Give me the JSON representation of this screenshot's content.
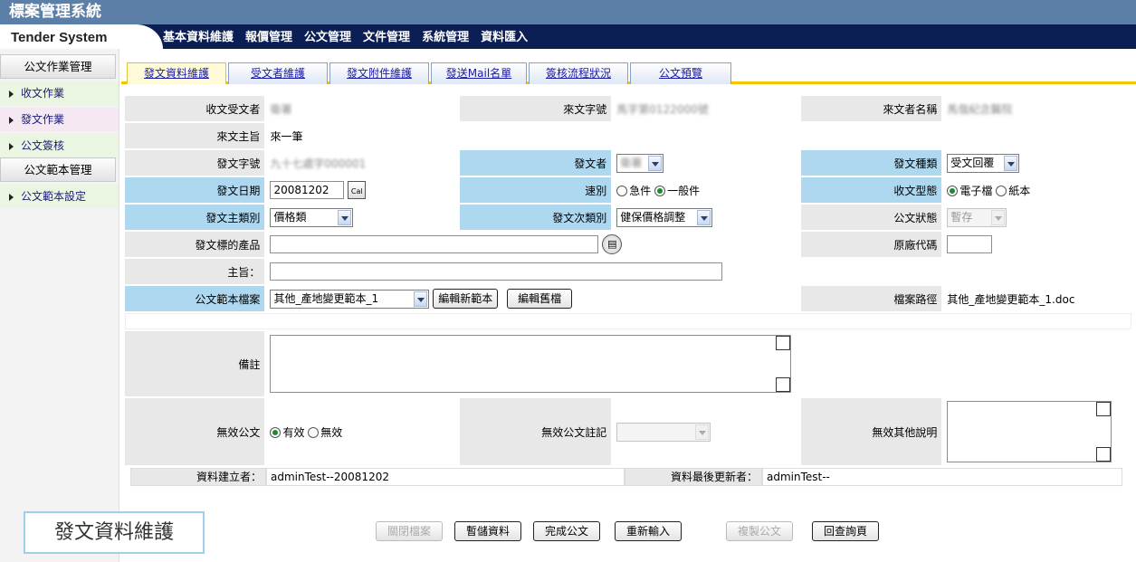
{
  "app": {
    "title": "標案管理系統",
    "brand": "Tender System"
  },
  "topmenu": [
    "基本資料維護",
    "報價管理",
    "公文管理",
    "文件管理",
    "系統管理",
    "資料匯入"
  ],
  "sidebar": {
    "section1": "公文作業管理",
    "items1": [
      "收文作業",
      "發文作業",
      "公文簽核"
    ],
    "section2": "公文範本管理",
    "items2": [
      "公文範本設定"
    ]
  },
  "tabs": [
    "發文資料維護",
    "受文者維護",
    "發文附件維護",
    "發送Mail名單",
    "簽核流程狀況",
    "公文預覽"
  ],
  "form": {
    "recv_label": "收文受文者",
    "recv_value": "衛署",
    "incoming_no_label": "來文字號",
    "incoming_no_value": "馬字第0122000號",
    "sender_name_label": "來文者名稱",
    "sender_name_value": "馬偕紀念醫院",
    "incoming_subject_label": "來文主旨",
    "incoming_subject_value": "來一筆",
    "doc_no_label": "發文字號",
    "doc_no_value": "九十七處字000001",
    "sender_label": "發文者",
    "sender_value": "衛署",
    "doc_type_label": "發文種類",
    "doc_type_value": "受文回覆",
    "date_label": "發文日期",
    "date_value": "20081202",
    "cal_label": "Cal",
    "speed_label": "速別",
    "speed_options": [
      "急件",
      "一般件"
    ],
    "format_label": "收文型態",
    "format_options": [
      "電子檔",
      "紙本"
    ],
    "main_cat_label": "發文主類別",
    "main_cat_value": "價格類",
    "sub_cat_label": "發文次類別",
    "sub_cat_value": "健保價格調整",
    "status_label": "公文狀態",
    "status_value": "暫存",
    "product_label": "發文標的產品",
    "factory_label": "原廠代碼",
    "subject_label": "主旨：",
    "template_label": "公文範本檔案",
    "template_value": "其他_產地變更範本_1",
    "edit_new_label": "編輯新範本",
    "edit_old_label": "編輯舊檔",
    "path_label": "檔案路徑",
    "path_value": "其他_產地變更範本_1.doc",
    "remark_label": "備註",
    "invalid_label": "無效公文",
    "invalid_options": [
      "有效",
      "無效"
    ],
    "invalid_note_label": "無效公文註記",
    "invalid_other_label": "無效其他說明",
    "creator_label": "資料建立者：",
    "creator_value": "adminTest--20081202",
    "updater_label": "資料最後更新者：",
    "updater_value": "adminTest--"
  },
  "buttons": [
    "關閉檔案",
    "暫儲資料",
    "完成公文",
    "重新輸入",
    "複製公文",
    "回查詢頁"
  ],
  "overlay_label": "發文資料維護"
}
